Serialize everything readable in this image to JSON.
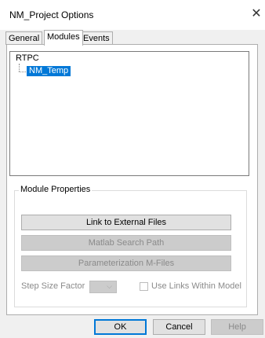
{
  "window": {
    "title": "NM_Project Options",
    "close_glyph": "✕"
  },
  "tabs": [
    {
      "label": "General",
      "active": false
    },
    {
      "label": "Modules",
      "active": true
    },
    {
      "label": "Events",
      "active": false
    }
  ],
  "tree": {
    "root": "RTPC",
    "children": [
      "NM_Temp"
    ],
    "selected": "NM_Temp"
  },
  "module_properties": {
    "title": "Module Properties",
    "buttons": [
      {
        "label": "Link to External Files",
        "enabled": true
      },
      {
        "label": "Matlab Search Path",
        "enabled": false
      },
      {
        "label": "Parameterization M-Files",
        "enabled": false
      }
    ],
    "step_size_label": "Step Size Factor",
    "step_size_value": "",
    "use_links_label": "Use Links Within Model",
    "use_links_checked": false
  },
  "footer": {
    "ok": "OK",
    "cancel": "Cancel",
    "help": "Help"
  },
  "colors": {
    "selection": "#0078d7",
    "dialog_bg": "#f0f0f0",
    "disabled_text": "#8a8a8a"
  }
}
